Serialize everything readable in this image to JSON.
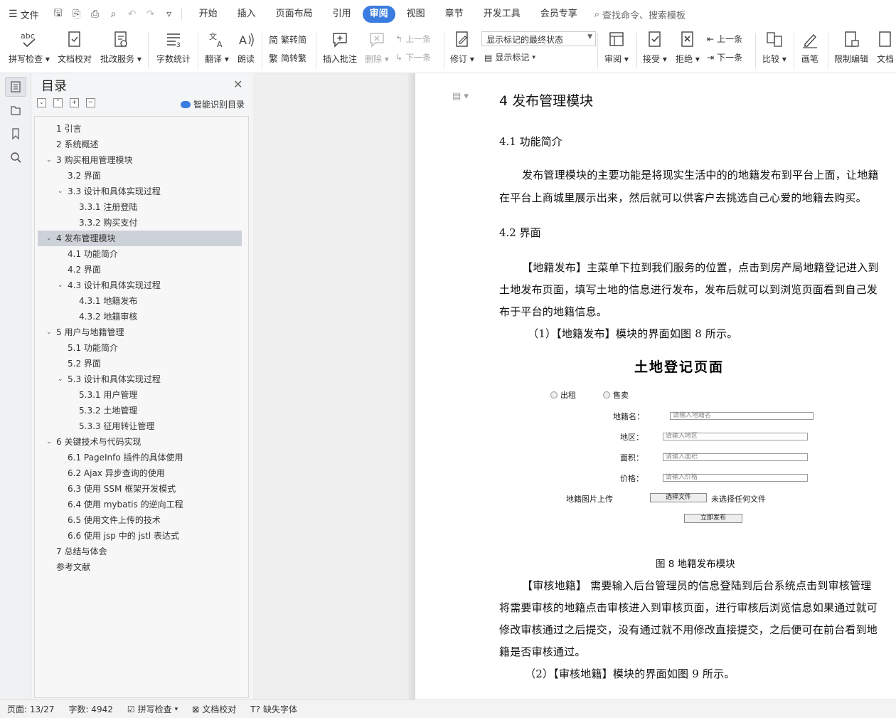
{
  "menubar": {
    "file_label": "文件",
    "tabs": [
      {
        "label": "开始"
      },
      {
        "label": "插入"
      },
      {
        "label": "页面布局"
      },
      {
        "label": "引用"
      },
      {
        "label": "审阅",
        "active": true
      },
      {
        "label": "视图"
      },
      {
        "label": "章节"
      },
      {
        "label": "开发工具"
      },
      {
        "label": "会员专享"
      }
    ],
    "search_placeholder": "查找命令、搜索模板"
  },
  "ribbon": {
    "spell_check": "拼写检查",
    "doc_proof": "文档校对",
    "annotate_service": "批改服务",
    "word_count": "字数统计",
    "translate": "翻译",
    "read_aloud": "朗读",
    "to_traditional": "繁转简",
    "to_simplified": "简转繁",
    "insert_comment": "插入批注",
    "delete": "删除",
    "prev_comment": "上一条",
    "next_comment": "下一条",
    "track_changes": "修订",
    "display_mode": "显示标记的最终状态",
    "show_markup": "显示标记",
    "review": "审阅",
    "accept": "接受",
    "reject": "拒绝",
    "prev_change": "上一条",
    "next_change": "下一条",
    "compare": "比较",
    "ink": "画笔",
    "restrict_edit": "限制编辑",
    "doc_rights": "文档"
  },
  "toc": {
    "title": "目录",
    "smart_label": "智能识别目录",
    "items": [
      {
        "text": "1  引言",
        "level": 1,
        "arrow": ""
      },
      {
        "text": "2  系统概述",
        "level": 1,
        "arrow": ""
      },
      {
        "text": "3  购买租用管理模块",
        "level": 1,
        "arrow": "v"
      },
      {
        "text": "3.2  界面",
        "level": 2,
        "arrow": ""
      },
      {
        "text": "3.3  设计和具体实现过程",
        "level": 2,
        "arrow": "v"
      },
      {
        "text": "3.3.1  注册登陆",
        "level": 3,
        "arrow": ""
      },
      {
        "text": "3.3.2 购买支付",
        "level": 3,
        "arrow": ""
      },
      {
        "text": "4  发布管理模块",
        "level": 1,
        "arrow": "v",
        "selected": true
      },
      {
        "text": "4.1  功能简介",
        "level": 2,
        "arrow": ""
      },
      {
        "text": "4.2 界面",
        "level": 2,
        "arrow": ""
      },
      {
        "text": "4.3 设计和具体实现过程",
        "level": 2,
        "arrow": "v"
      },
      {
        "text": "4.3.1 地籍发布",
        "level": 3,
        "arrow": ""
      },
      {
        "text": "4.3.2 地籍审核",
        "level": 3,
        "arrow": ""
      },
      {
        "text": "5 用户与地籍管理",
        "level": 1,
        "arrow": "v"
      },
      {
        "text": "5.1 功能简介",
        "level": 2,
        "arrow": ""
      },
      {
        "text": "5.2 界面",
        "level": 2,
        "arrow": ""
      },
      {
        "text": "5.3 设计和具体实现过程",
        "level": 2,
        "arrow": "v"
      },
      {
        "text": "5.3.1 用户管理",
        "level": 3,
        "arrow": ""
      },
      {
        "text": "5.3.2 土地管理",
        "level": 3,
        "arrow": ""
      },
      {
        "text": "5.3.3 征用转让管理",
        "level": 3,
        "arrow": ""
      },
      {
        "text": "6 关键技术与代码实现",
        "level": 1,
        "arrow": "v"
      },
      {
        "text": "6.1 PageInfo 插件的具体使用",
        "level": 2,
        "arrow": ""
      },
      {
        "text": "6.2 Ajax 异步查询的使用",
        "level": 2,
        "arrow": ""
      },
      {
        "text": "6.3 使用 SSM 框架开发模式",
        "level": 2,
        "arrow": ""
      },
      {
        "text": "6.4  使用 mybatis 的逆向工程",
        "level": 2,
        "arrow": ""
      },
      {
        "text": "6.5  使用文件上传的技术",
        "level": 2,
        "arrow": ""
      },
      {
        "text": "6.6  使用 jsp 中的 jstl 表达式",
        "level": 2,
        "arrow": ""
      },
      {
        "text": "7  总结与体会",
        "level": 1,
        "arrow": ""
      },
      {
        "text": "参考文献",
        "level": 1,
        "arrow": ""
      }
    ]
  },
  "document": {
    "h1": "4  发布管理模块",
    "h2_intro": "4.1  功能简介",
    "p1_line1": "发布管理模块的主要功能是将现实生活中的的地籍发布到平台上面，让地籍",
    "p1_line2": "在平台上商城里展示出来，然后就可以供客户去挑选自己心爱的地籍去购买。",
    "h2_ui": "4.2 界面",
    "p2_line1": "【地籍发布】主菜单下拉到我们服务的位置，点击到房产局地籍登记进入到",
    "p2_line2": "土地发布页面，填写土地的信息进行发布，发布后就可以到浏览页面看到自己发",
    "p2_line3": "布于平台的地籍信息。",
    "p3": "（1）【地籍发布】模块的界面如图 8 所示。",
    "figure": {
      "title": "土地登记页面",
      "radio_rent": "出租",
      "radio_sell": "售卖",
      "label_name": "地籍名：",
      "ph_name": "请输入地籍名",
      "label_area_region": "地区：",
      "ph_region": "请输入地区",
      "label_size": "面积：",
      "ph_size": "请输入面积",
      "label_price": "价格：",
      "ph_price": "请输入价格",
      "label_upload": "地籍图片上传",
      "choose_file": "选择文件",
      "no_file": "未选择任何文件",
      "submit": "立即发布"
    },
    "caption": "图 8  地籍发布模块",
    "p4_line1": "【审核地籍】 需要输入后台管理员的信息登陆到后台系统点击到审核管理",
    "p4_line2": "将需要审核的地籍点击审核进入到审核页面，进行审核后浏览信息如果通过就可",
    "p4_line3": "修改审核通过之后提交，没有通过就不用修改直接提交，之后便可在前台看到地",
    "p4_line4": "籍是否审核通过。",
    "p5": "（2）【审核地籍】模块的界面如图 9 所示。"
  },
  "statusbar": {
    "page": "页面: 13/27",
    "words": "字数: 4942",
    "spell": "拼写检查",
    "proof": "文档校对",
    "missing_font": "缺失字体"
  },
  "colors": {
    "accent": "#3a7ce0",
    "toc_selected": "#cdd1d8"
  }
}
